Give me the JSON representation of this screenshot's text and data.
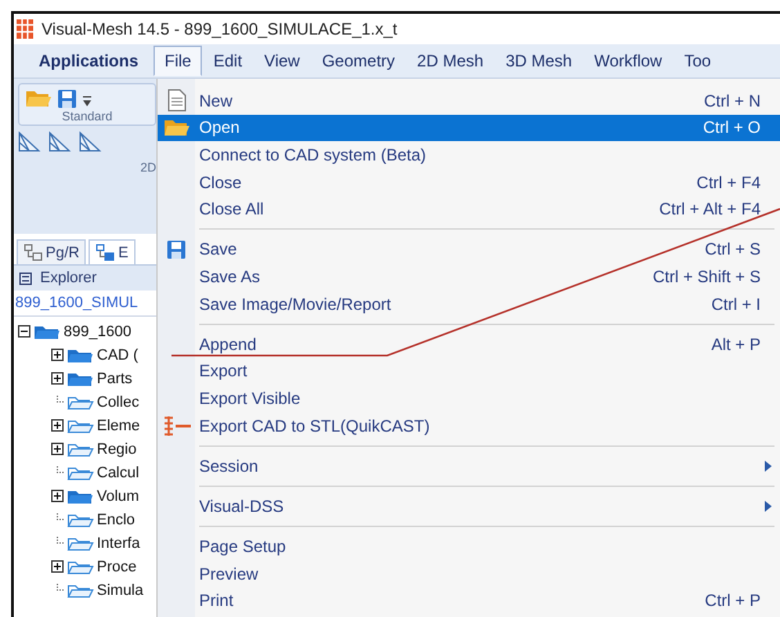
{
  "window": {
    "title": "Visual-Mesh 14.5 - 899_1600_SIMULACE_1.x_t"
  },
  "menubar": [
    {
      "label": "Applications",
      "kind": "app",
      "selected": false
    },
    {
      "label": "File",
      "kind": "menu",
      "selected": true
    },
    {
      "label": "Edit",
      "kind": "menu",
      "selected": false
    },
    {
      "label": "View",
      "kind": "menu",
      "selected": false
    },
    {
      "label": "Geometry",
      "kind": "menu",
      "selected": false
    },
    {
      "label": "2D Mesh",
      "kind": "menu",
      "selected": false
    },
    {
      "label": "3D Mesh",
      "kind": "menu",
      "selected": false
    },
    {
      "label": "Workflow",
      "kind": "menu",
      "selected": false
    },
    {
      "label": "Too",
      "kind": "menu",
      "selected": false
    }
  ],
  "ribbon": {
    "groups": [
      "Standard",
      "2D"
    ]
  },
  "panel_tabs": [
    {
      "label": "Pg/R",
      "selected": false
    },
    {
      "label": "E",
      "selected": true
    }
  ],
  "explorer": {
    "header": "Explorer",
    "path": "899_1600_SIMUL",
    "tree": [
      {
        "label": "899_1600",
        "kind": "node",
        "expanded": true,
        "filled": true,
        "children": [
          {
            "label": "CAD (",
            "kind": "node",
            "expanded": false,
            "filled": true
          },
          {
            "label": "Parts",
            "kind": "node",
            "expanded": false,
            "filled": true
          },
          {
            "label": "Collec",
            "kind": "leaf",
            "filled": false
          },
          {
            "label": "Eleme",
            "kind": "node",
            "expanded": false,
            "filled": false
          },
          {
            "label": "Regio",
            "kind": "node",
            "expanded": false,
            "filled": false
          },
          {
            "label": "Calcul",
            "kind": "leaf",
            "filled": false
          },
          {
            "label": "Volum",
            "kind": "node",
            "expanded": false,
            "filled": true
          },
          {
            "label": "Enclo",
            "kind": "leaf",
            "filled": false
          },
          {
            "label": "Interfa",
            "kind": "leaf",
            "filled": false
          },
          {
            "label": "Proce",
            "kind": "node",
            "expanded": false,
            "filled": false
          },
          {
            "label": "Simula",
            "kind": "leaf",
            "filled": false
          }
        ]
      }
    ]
  },
  "file_menu": [
    {
      "kind": "item",
      "label": "New",
      "shortcut": "Ctrl + N",
      "selected": false
    },
    {
      "kind": "item",
      "label": "Open",
      "shortcut": "Ctrl + O",
      "selected": true
    },
    {
      "kind": "item",
      "label": "Connect to CAD system (Beta)",
      "selected": false
    },
    {
      "kind": "item",
      "label": "Close",
      "shortcut": "Ctrl + F4",
      "selected": false
    },
    {
      "kind": "item",
      "label": "Close All",
      "shortcut": "Ctrl + Alt + F4",
      "selected": false
    },
    {
      "kind": "separator"
    },
    {
      "kind": "item",
      "label": "Save",
      "shortcut": "Ctrl + S",
      "selected": false
    },
    {
      "kind": "item",
      "label": "Save As",
      "shortcut": "Ctrl + Shift + S",
      "selected": false
    },
    {
      "kind": "item",
      "label": "Save Image/Movie/Report",
      "shortcut": "Ctrl + I",
      "selected": false
    },
    {
      "kind": "separator"
    },
    {
      "kind": "item",
      "label": "Append",
      "shortcut": "Alt + P",
      "selected": false
    },
    {
      "kind": "item",
      "label": "Export",
      "selected": false
    },
    {
      "kind": "item",
      "label": "Export Visible",
      "selected": false
    },
    {
      "kind": "item",
      "label": "Export CAD to STL(QuikCAST)",
      "selected": false
    },
    {
      "kind": "separator"
    },
    {
      "kind": "item",
      "label": "Session",
      "submenu": true,
      "selected": false
    },
    {
      "kind": "separator"
    },
    {
      "kind": "item",
      "label": "Visual-DSS",
      "submenu": true,
      "selected": false
    },
    {
      "kind": "separator"
    },
    {
      "kind": "item",
      "label": "Page Setup",
      "selected": false
    },
    {
      "kind": "item",
      "label": "Preview",
      "selected": false
    },
    {
      "kind": "item",
      "label": "Print",
      "shortcut": "Ctrl + P",
      "selected": false
    }
  ]
}
